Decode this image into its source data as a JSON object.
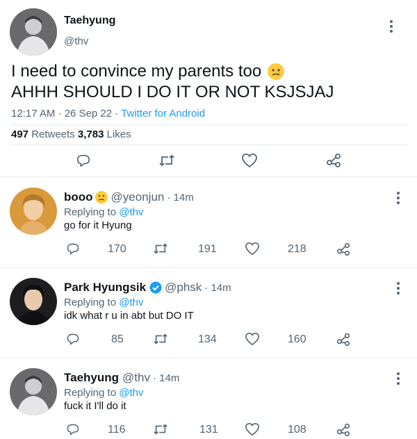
{
  "main_tweet": {
    "name": "Taehyung",
    "handle": "@thv",
    "text_line1": "I need to convince my parents too",
    "text_line2": "AHHH SHOULD I DO IT OR NOT KSJSJAJ",
    "time": "12:17 AM · 26 Sep 22 · ",
    "source": "Twitter for Android",
    "retweets_count": "497",
    "retweets_label": "Retweets",
    "likes_count": "3,783",
    "likes_label": "Likes"
  },
  "replies": [
    {
      "name": "booo",
      "handle": "@yeonjun",
      "time": "· 14m",
      "replying_label": "Replying to",
      "replying_to": "@thv",
      "text": "go for it Hyung",
      "replies": "170",
      "retweets": "191",
      "likes": "218"
    },
    {
      "name": "Park Hyungsik",
      "handle": "@phsk",
      "time": "· 14m",
      "replying_label": "Replying to",
      "replying_to": "@thv",
      "text": "idk what r u in abt but DO IT",
      "replies": "85",
      "retweets": "134",
      "likes": "160"
    },
    {
      "name": "Taehyung",
      "handle": "@thv",
      "time": "· 14m",
      "replying_label": "Replying to",
      "replying_to": "@thv",
      "text": "fuck it I'll do it",
      "replies": "116",
      "retweets": "131",
      "likes": "108"
    }
  ],
  "icons": [
    "more-icon",
    "reply-icon",
    "retweet-icon",
    "like-icon",
    "share-icon",
    "emoji-icon",
    "verified-icon"
  ],
  "colors": {
    "accent": "#1d9bf0",
    "muted": "#536471",
    "text": "#0f1419"
  }
}
